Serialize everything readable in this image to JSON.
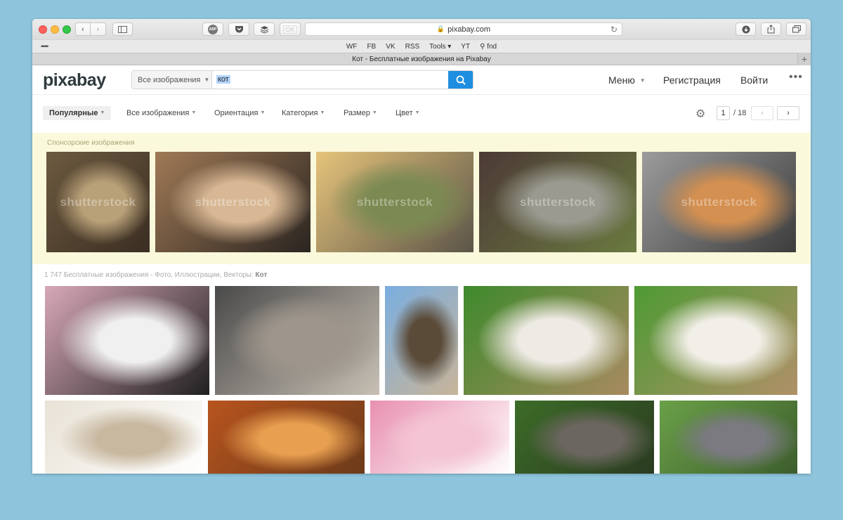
{
  "browser": {
    "url": "pixabay.com",
    "tab_title": "Кот - Бесплатные изображения на Pixabay",
    "extensions": [
      "ABP",
      "",
      "",
      "OK"
    ],
    "favorites": [
      "WF",
      "FB",
      "VK",
      "RSS",
      "Tools ▾",
      "YT",
      "⚲ fnd"
    ]
  },
  "header": {
    "logo": "pixabay",
    "search_type": "Все изображения",
    "search_query": "кот",
    "menu": "Меню",
    "register": "Регистрация",
    "login": "Войти"
  },
  "filters": {
    "popular": "Популярные",
    "all_images": "Все изображения",
    "orientation": "Ориентация",
    "category": "Категория",
    "size": "Размер",
    "color": "Цвет"
  },
  "pagination": {
    "current": "1",
    "total": "/ 18",
    "prev": "‹",
    "next": "›"
  },
  "sponsored": {
    "label": "Спонсорские изображения",
    "watermark": "shutterstock",
    "images": [
      {
        "name": "tabby-cat-face",
        "colors": [
          "#6d5a40",
          "#b8a078",
          "#3a2e22"
        ]
      },
      {
        "name": "black-cat-under-bench",
        "colors": [
          "#a07a56",
          "#d8b894",
          "#2a2420"
        ]
      },
      {
        "name": "cat-sitting-on-road",
        "colors": [
          "#e6c47a",
          "#7a8a52",
          "#5b5448"
        ]
      },
      {
        "name": "cat-sitting-by-fence",
        "colors": [
          "#4c3a36",
          "#9a9a90",
          "#6a7a40"
        ]
      },
      {
        "name": "ginger-cat-lying",
        "colors": [
          "#9c9c9c",
          "#d49050",
          "#3c3c3c"
        ]
      }
    ]
  },
  "results": {
    "count_text": "1 747 Бесплатные изображения - Фото, Иллюстрации, Векторы: ",
    "query_bold": "Кот",
    "row1": [
      {
        "name": "black-white-cat-portrait",
        "colors": [
          "#d8a8b8",
          "#f0f0f0",
          "#202020"
        ]
      },
      {
        "name": "kittens-on-street",
        "colors": [
          "#4a4a4a",
          "#9e968c",
          "#c8c0b4"
        ]
      },
      {
        "name": "kitten-in-tree",
        "colors": [
          "#7aaee0",
          "#5a4a38",
          "#c8b498"
        ]
      },
      {
        "name": "sleeping-white-cat",
        "colors": [
          "#3e8a2c",
          "#eeeae4",
          "#a88a60"
        ]
      },
      {
        "name": "sleeping-cat-on-back",
        "colors": [
          "#4e9a34",
          "#f2efe8",
          "#b09068"
        ]
      }
    ],
    "row2": [
      {
        "name": "sleeping-kitten",
        "colors": [
          "#e8e2d6",
          "#c8b8a0",
          "#ffffff"
        ]
      },
      {
        "name": "ginger-kitten",
        "colors": [
          "#b8541e",
          "#e8a050",
          "#6a3a1a"
        ]
      },
      {
        "name": "kitten-in-pink-blanket",
        "colors": [
          "#e890b0",
          "#f4c4d4",
          "#ffffff"
        ]
      },
      {
        "name": "kittens-in-grass",
        "colors": [
          "#3c6c28",
          "#6c6660",
          "#2a3a20"
        ]
      },
      {
        "name": "gray-cat-in-grass",
        "colors": [
          "#6aa048",
          "#7a7a80",
          "#3c5c2c"
        ]
      }
    ]
  }
}
